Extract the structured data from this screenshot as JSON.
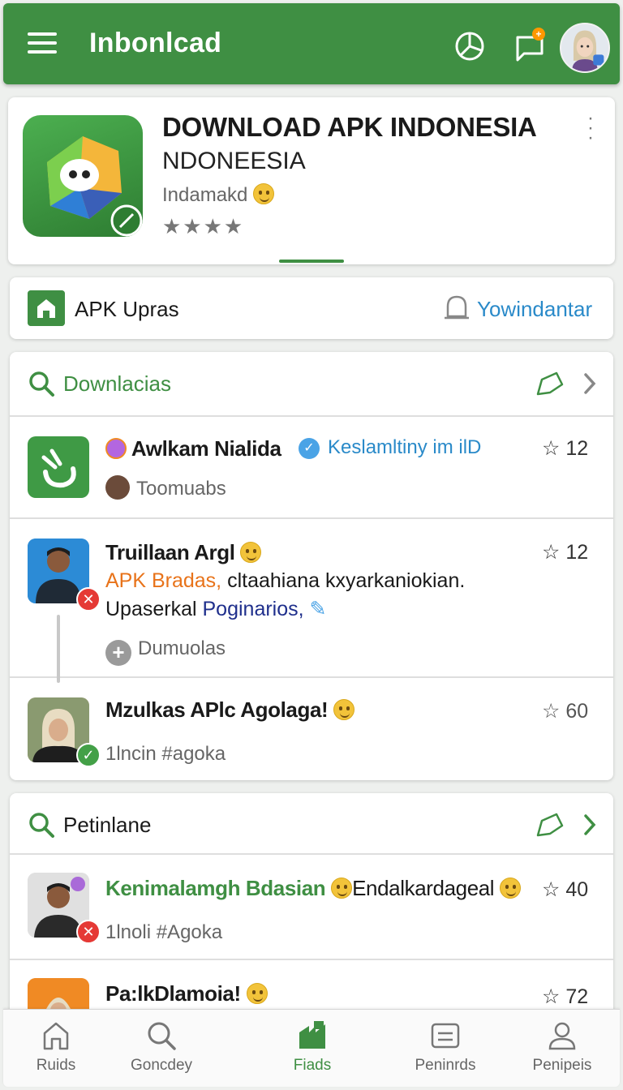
{
  "appbar": {
    "title": "Inbonlcad",
    "icons": [
      "menu-icon",
      "chart-icon",
      "chat-icon",
      "profile-avatar"
    ],
    "notification_badge": "+"
  },
  "app_card": {
    "title": "DOWNLOAD APK INDONESIA",
    "subtitle": "NDONEESIA",
    "meta": "Indamakd",
    "stars": "★★★★",
    "rating_stars": 4
  },
  "upras_bar": {
    "label": "APK Upras",
    "link": "Yowindantar"
  },
  "section1": {
    "heading": "Downlacias",
    "rows": [
      {
        "title": "Awlkam Nialida",
        "link": "Keslamltiny im ilD",
        "sub": "Toomuabs",
        "count": "12"
      },
      {
        "title": "Truillaan Argl",
        "line1_highlight": "APK Bradas,",
        "line1_rest": " cltaahiana kxyarkaniokian.",
        "line2_start": "Upaserkal ",
        "line2_link": "Poginarios,",
        "action": "Dumuolas",
        "count": "12"
      },
      {
        "title": "Mzulkas APlc Agolaga!",
        "sub": "1lncin #agoka",
        "count": "60"
      }
    ]
  },
  "section2": {
    "heading": "Petinlane",
    "rows": [
      {
        "title_green": "Kenimalamgh Bdasian",
        "title_rest": "Endalkardageal",
        "sub": "1lnoli #Agoka",
        "count": "40"
      },
      {
        "title": "Pa:lkDlamoia!",
        "count": "72"
      }
    ]
  },
  "bottom_nav": [
    {
      "label": "Ruids",
      "icon": "home-icon"
    },
    {
      "label": "Goncdey",
      "icon": "search-icon"
    },
    {
      "label": "Fiads",
      "icon": "feeds-icon",
      "active": true
    },
    {
      "label": "Peninrds",
      "icon": "list-icon"
    },
    {
      "label": "Penipeis",
      "icon": "profile-icon"
    }
  ],
  "colors": {
    "brand_green": "#3f8f43",
    "link_blue": "#2a8ac9",
    "highlight_orange": "#e8731a",
    "link_navy": "#1f2f8c"
  }
}
